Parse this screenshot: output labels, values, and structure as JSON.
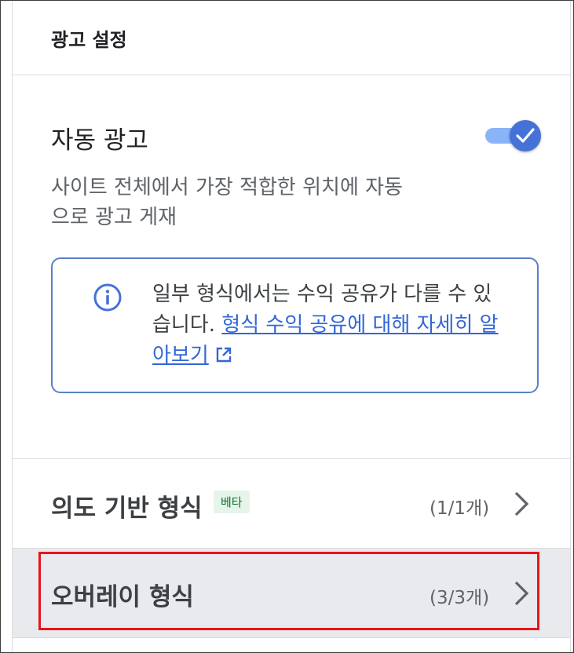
{
  "header": {
    "title": "광고 설정"
  },
  "auto_ads": {
    "title": "자동 광고",
    "toggle_on": true,
    "description": "사이트 전체에서 가장 적합한 위치에 자동으로 광고 게재"
  },
  "info": {
    "text": "일부 형식에서는 수익 공유가 다를 수 있습니다.",
    "link_label": "형식 수익 공유에 대해 자세히 알아보기",
    "icon": "info-icon",
    "link_icon": "external-link-icon"
  },
  "formats": [
    {
      "title": "의도 기반 형식",
      "badge": "베타",
      "count": "(1/1개)",
      "icon": "chevron-right-icon"
    },
    {
      "title": "오버레이 형식",
      "count": "(3/3개)",
      "icon": "chevron-right-icon"
    }
  ],
  "colors": {
    "accent": "#4672d8",
    "toggle_track": "#8ab4f8",
    "link": "#3367d6",
    "info_border": "#5b7fc7",
    "badge_bg": "#e6f4ea",
    "badge_text": "#137333",
    "selected_row_bg": "#e8eaed",
    "highlight_outline": "#e8141c"
  }
}
